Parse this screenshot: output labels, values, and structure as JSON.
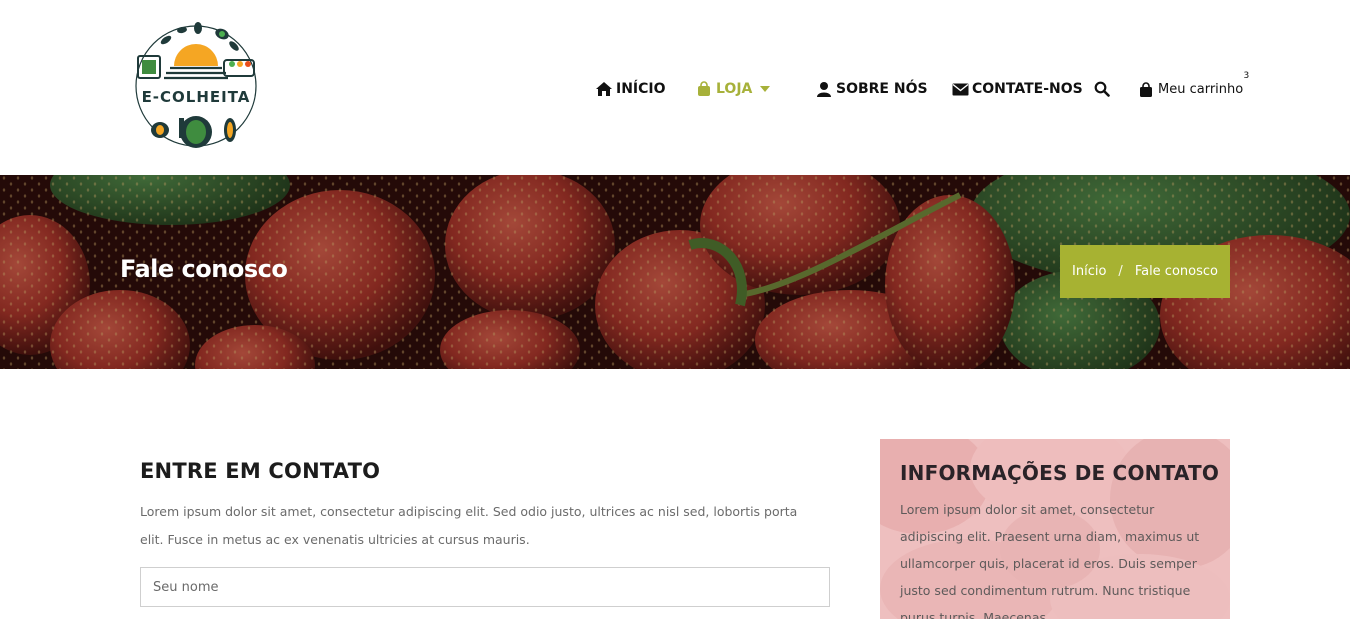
{
  "brand": {
    "name": "E-COLHEITA",
    "accent_color": "#a7b232"
  },
  "nav": {
    "items": [
      {
        "label": "INÍCIO",
        "icon": "home-icon"
      },
      {
        "label": "LOJA",
        "icon": "shopping-bag-icon",
        "active": true,
        "has_dropdown": true
      },
      {
        "label": "SOBRE NÓS",
        "icon": "user-icon"
      },
      {
        "label": "CONTATE-NOS",
        "icon": "envelope-icon"
      }
    ],
    "search_icon": "search-icon",
    "cart": {
      "label": "Meu carrinho",
      "count": "3",
      "icon": "shopping-bag-icon"
    }
  },
  "hero": {
    "title": "Fale conosco",
    "breadcrumb": {
      "home": "Início",
      "separator": "/",
      "current": "Fale conosco"
    }
  },
  "contact": {
    "title": "ENTRE EM CONTATO",
    "text": "Lorem ipsum dolor sit amet, consectetur adipiscing elit. Sed odio justo, ultrices ac nisl sed, lobortis porta elit. Fusce in metus ac ex venenatis ultricies at cursus mauris.",
    "name_placeholder": "Seu nome"
  },
  "info": {
    "title": "INFORMAÇÕES DE CONTATO",
    "text": "Lorem ipsum dolor sit amet, consectetur adipiscing elit. Praesent urna diam, maximus ut ullamcorper quis, placerat id eros. Duis semper justo sed condimentum rutrum. Nunc tristique purus turpis. Maecenas"
  }
}
